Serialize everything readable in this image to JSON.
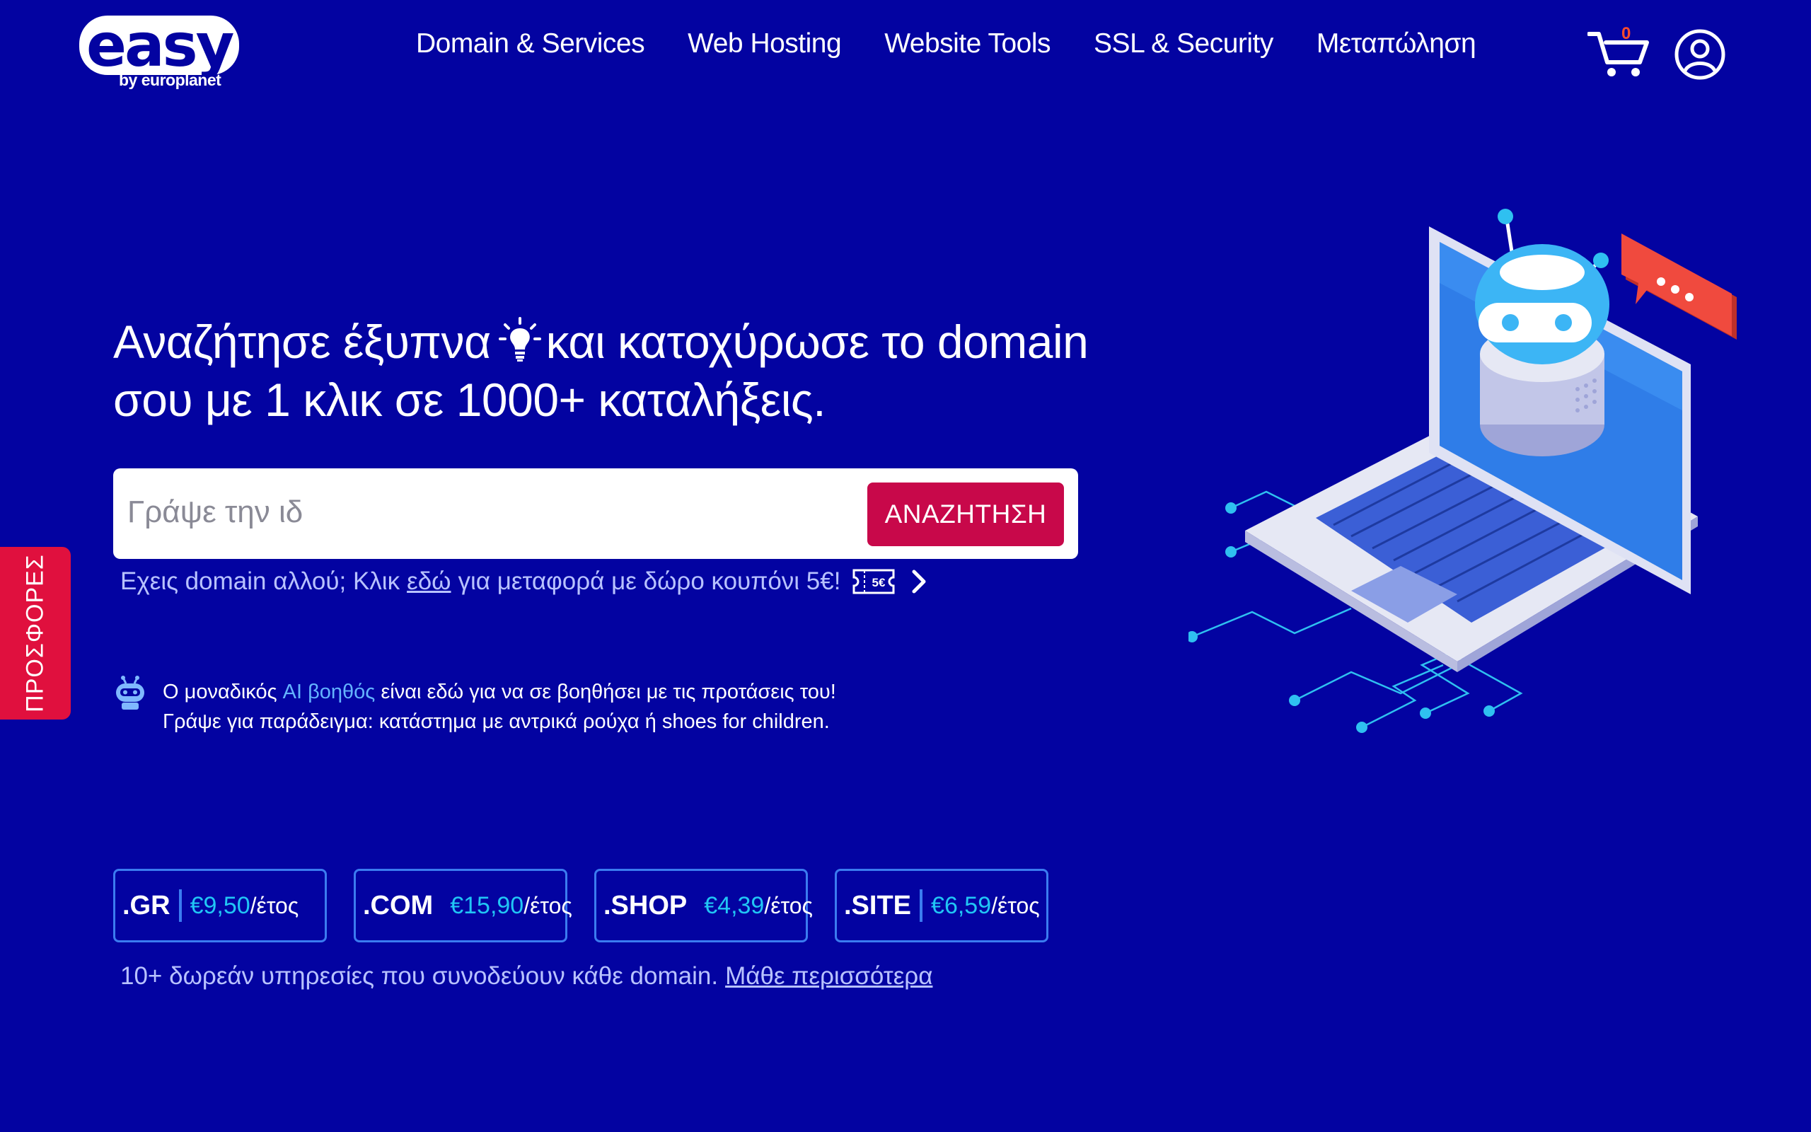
{
  "header": {
    "logo_text": "easy",
    "logo_sub": "by europlanet",
    "nav": [
      "Domain & Services",
      "Web Hosting",
      "Website Tools",
      "SSL & Security",
      "Μεταπώληση"
    ],
    "cart_count": "0"
  },
  "hero": {
    "headline_part1": "Αναζήτησε έξυπνα",
    "headline_part2": "και κατοχύρωσε το domain σου με 1 κλικ σε 1000+ καταλήξεις."
  },
  "search": {
    "placeholder": "Γράψε την ιδ",
    "button_label": "ΑΝΑΖΗΤΗΣΗ"
  },
  "transfer": {
    "text_before": "Εχεις domain αλλού; Κλικ",
    "link": "εδώ",
    "text_after": "για μεταφορά με δώρο κουπόνι 5€!",
    "coupon_badge": "5€"
  },
  "ai_helper": {
    "line1_before": "Ο μοναδικός",
    "line1_highlight": "AI βοηθός",
    "line1_after": "είναι εδώ για να σε βοηθήσει με τις προτάσεις του!",
    "line2": "Γράψε για παράδειγμα: κατάστημα με αντρικά ρούχα ή shoes for children."
  },
  "offers_tab": "ΠΡΟΣΦΟΡΕΣ",
  "tlds": [
    {
      "name": ".GR",
      "price": "€9,50",
      "unit": " /έτος"
    },
    {
      "name": ".COM",
      "price": "€15,90",
      "unit": "/έτος"
    },
    {
      "name": ".SHOP",
      "price": "€4,39",
      "unit": "/έτος"
    },
    {
      "name": ".SITE",
      "price": "€6,59",
      "unit": "/έτος"
    }
  ],
  "benefits": {
    "text": "10+ δωρεάν υπηρεσίες που συνοδεύουν κάθε domain.",
    "link": "Μάθε περισσότερα"
  },
  "colors": {
    "background": "#0303a1",
    "accent": "#c8084a",
    "tld_border": "#3b7cf0",
    "price": "#21c6f5",
    "link_muted": "#b8c2ff"
  },
  "icons": [
    "cart-icon",
    "user-icon",
    "lightbulb-icon",
    "coupon-icon",
    "chevron-right-icon",
    "ai-robot-icon"
  ]
}
